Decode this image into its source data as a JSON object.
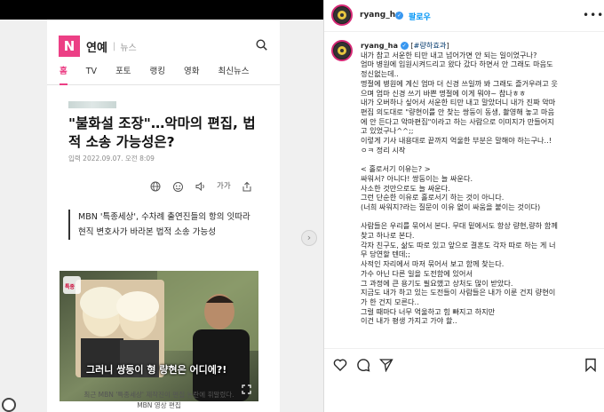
{
  "article": {
    "logo_letter": "N",
    "section": "연예",
    "separator": "|",
    "news_label": "뉴스",
    "tabs": [
      "홈",
      "TV",
      "포토",
      "랭킹",
      "영화",
      "최신뉴스"
    ],
    "active_tab": 0,
    "headline": "\"불화설 조장\"…악마의 편집, 법적 소송 가능성은?",
    "date": "입력 2022.09.07. 오전 8:09",
    "text_size_label": "가가",
    "subheadlines": [
      "MBN '특종세상', 수차례 출연진들의 항의 잇따라",
      "현직 변호사가 바라본 법적 소송 가능성"
    ],
    "photo_subtitle": "그러니 쌍둥이 형 량현은 어디에?!",
    "photo_channel": "특종",
    "caption_lines": [
      "최근 MBN '특종세상' 제작진이 편집 논란에 휘말렸다.",
      "MBN 영상 편집"
    ]
  },
  "post": {
    "username": "ryang_ha",
    "follow_label": "팔로우",
    "more_icon": "•••",
    "hashtag": "#량하효과",
    "caption": "내가 참고 서운한 티만 내고 넘어가면 안 되는 일이었구나?\n엄마 병원에 입원시켜드리고 왔다 갔다 하면서 안 그래도 마음도\n정신없는데..\n명절에 병원에 계신 엄마 더 신경 쓰일까 봐 그래도 즐거우려고 웃\n으며 엄마 신경 쓰기 바쁜 명절에 이게 뭐야~ 참나ㅎㅎ\n내가 오버하나 싶어서 서운한 티만 내고 말았더니 내가 진짜 악마\n편집 의도대로 \"량현이를 안 찾는 쌍둥이 동생, 촬영해 놓고 마음\n에 안 든다고 악마편집\"이라고 하는 사람으로 이미지가 만들어지\n고 있었구나^^;;\n이렇게 기사 내용대로 끝까지 억울한 부분은 말해야 하는구나..!\nㅇㅋ 정리 시작\n\n< 홀로서기 이유는? >\n싸워서? 아니다! 쌍둥이는 늘 싸운다.\n사소한 것만으로도 늘 싸운다.\n그런 단순한 이유로 홀로서기 하는 것이 아니다.\n(너희 싸워지?라는 질문이 이유 없이 싸움을 붙이는 것이다)\n\n사람들은 우리를 묶어서 본다. 무대 밑에서도 항상 량현,량하 함께\n찾고 하나로 본다.\n각자 친구도, 삶도 따로 있고 앞으로 결혼도 각자 따로 하는 게 너\n무 당연할 텐데;;\n사적인 자리에서 마저 묶어서 보고 함께 찾는다.\n가수 아닌 다른 일을 도전함에 있어서\n그 과정에 큰 용기도 필요했고 상처도 많이 받았다.\n지금도 내가 하고 있는 도전들이 사람들은 내가 이룬 건지 량현이\n가 한 건지 모른다..\n그럴 때마다 너무 억울하고 힘 빠지고 하지만\n이건 내가 평생 가지고 가야 할.."
  },
  "colors": {
    "naver_pink": "#ec3f85",
    "ig_blue": "#0095f6",
    "verified_blue": "#3897f0"
  },
  "icons": [
    "search-icon",
    "globe-icon",
    "emoji-icon",
    "speaker-icon",
    "share-icon",
    "heart-icon",
    "comment-icon",
    "send-icon",
    "bookmark-icon",
    "more-icon",
    "chevron-right-icon"
  ]
}
